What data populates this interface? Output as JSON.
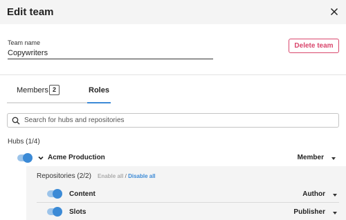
{
  "dialog": {
    "title": "Edit team",
    "close_icon": "close-icon"
  },
  "team": {
    "name_label": "Team name",
    "name_value": "Copywriters",
    "delete_label": "Delete team"
  },
  "tabs": [
    {
      "label": "Members",
      "badge": "2",
      "active": false
    },
    {
      "label": "Roles",
      "active": true
    }
  ],
  "search": {
    "placeholder": "Search for hubs and repositories",
    "icon": "search-icon"
  },
  "hubs": {
    "header": "Hubs (1/4)",
    "items": [
      {
        "name": "Acme Production",
        "enabled": true,
        "expanded": true,
        "role": "Member",
        "repositories": {
          "header": "Repositories (2/2)",
          "enable_all": "Enable all",
          "separator": "/",
          "disable_all": "Disable all",
          "items": [
            {
              "name": "Content",
              "enabled": true,
              "role": "Author"
            },
            {
              "name": "Slots",
              "enabled": true,
              "role": "Publisher"
            }
          ]
        }
      }
    ]
  },
  "colors": {
    "accent": "#3b8ad6",
    "toggle_track": "#9cc4ea",
    "danger": "#d9466c",
    "header_bg": "#f4f4f4"
  }
}
